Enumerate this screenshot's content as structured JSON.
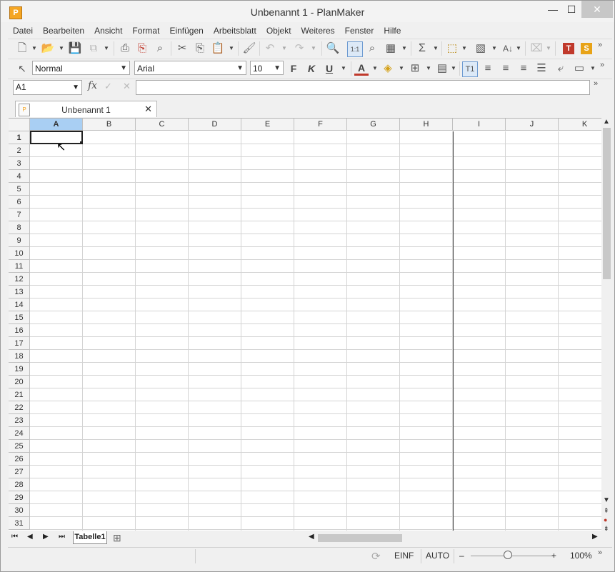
{
  "window": {
    "title": "Unbenannt 1 - PlanMaker",
    "app_icon": "P",
    "minimize_icon": "—",
    "maximize_icon": "☐",
    "close_icon": "✕"
  },
  "menu": [
    "Datei",
    "Bearbeiten",
    "Ansicht",
    "Format",
    "Einfügen",
    "Arbeitsblatt",
    "Objekt",
    "Weiteres",
    "Fenster",
    "Hilfe"
  ],
  "toolbar_more": "»",
  "format_toolbar": {
    "style": "Normal",
    "font": "Arial",
    "size": "10",
    "bold": "F",
    "italic": "K",
    "underline": "U",
    "font_color_glyph": "A",
    "accent_red": "#c0392b",
    "textmaker_badge": "T",
    "softmaker_badge": "S"
  },
  "formula_bar": {
    "cell_ref": "A1",
    "fx": "fx",
    "confirm": "✓",
    "cancel": "✕",
    "value": ""
  },
  "document_tab": {
    "label": "Unbenannt 1",
    "close": "✕"
  },
  "grid": {
    "columns": [
      "A",
      "B",
      "C",
      "D",
      "E",
      "F",
      "G",
      "H",
      "I",
      "J",
      "K"
    ],
    "rows": [
      "1",
      "2",
      "3",
      "4",
      "5",
      "6",
      "7",
      "8",
      "9",
      "10",
      "11",
      "12",
      "13",
      "14",
      "15",
      "16",
      "17",
      "18",
      "19",
      "20",
      "21",
      "22",
      "23",
      "24",
      "25",
      "26",
      "27",
      "28",
      "29",
      "30",
      "31"
    ],
    "selected_column": "A",
    "selected_row": "1"
  },
  "sheets": {
    "tabs": [
      "Tabelle1"
    ],
    "active": "Tabelle1"
  },
  "status": {
    "insert_mode": "EINF",
    "calc_mode": "AUTO",
    "zoom_minus": "–",
    "zoom_plus": "+",
    "zoom": "100%",
    "more": "»"
  }
}
